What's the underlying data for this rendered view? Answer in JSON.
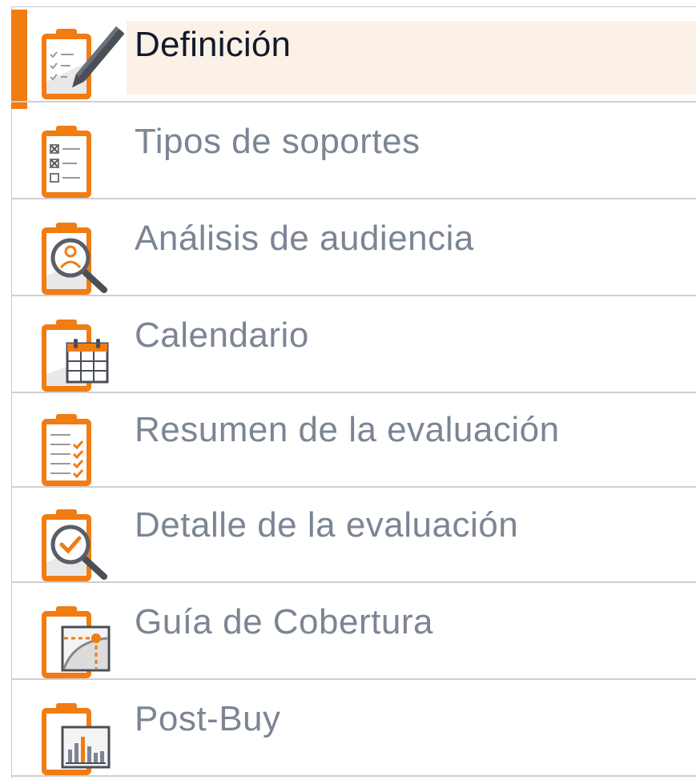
{
  "colors": {
    "accent": "#f07c12",
    "active_background": "#fcf1e6",
    "active_text": "#111a2c",
    "inactive_text": "#7b8594",
    "separator": "#cfcfcf"
  },
  "nav": {
    "items": [
      {
        "label": "Definición",
        "icon": "clipboard-pencil-icon",
        "active": true
      },
      {
        "label": "Tipos de soportes",
        "icon": "clipboard-checklist-icon",
        "active": false
      },
      {
        "label": "Análisis de audiencia",
        "icon": "clipboard-magnifier-user-icon",
        "active": false
      },
      {
        "label": "Calendario",
        "icon": "clipboard-calendar-icon",
        "active": false
      },
      {
        "label": "Resumen de la evaluación",
        "icon": "clipboard-checks-icon",
        "active": false
      },
      {
        "label": "Detalle de la evaluación",
        "icon": "clipboard-magnifier-check-icon",
        "active": false
      },
      {
        "label": "Guía de Cobertura",
        "icon": "clipboard-curve-chart-icon",
        "active": false
      },
      {
        "label": "Post-Buy",
        "icon": "clipboard-bar-chart-icon",
        "active": false
      }
    ]
  }
}
